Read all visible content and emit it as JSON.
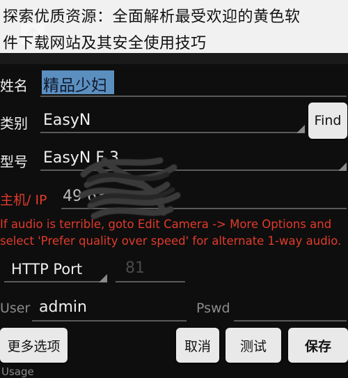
{
  "caption": {
    "line1": "探索优质资源：全面解析最受欢迎的黄色软",
    "line2": "件下载网站及其安全使用技巧"
  },
  "form": {
    "name_label": "姓名",
    "name_value": "精品少妇",
    "category_label": "类别",
    "category_value": "EasyN",
    "find_button": "Find",
    "model_label": "型号",
    "model_value": "EasyN F 3",
    "host_label": "主机/ IP",
    "host_value": "49 63",
    "warning_line1": "If audio is terrible, goto Edit Camera -> More Options and",
    "warning_line2": "select 'Prefer quality over speed' for alternate 1-way audio.",
    "port_type": "HTTP Port",
    "port_value": "81",
    "user_label": "User",
    "user_value": "admin",
    "pswd_label": "Pswd",
    "pswd_value": ""
  },
  "actions": {
    "more_options": "更多选项",
    "cancel": "取消",
    "test": "测试",
    "save": "保存"
  },
  "footer": {
    "partial_label": "Usage"
  },
  "colors": {
    "background": "#0e0e0e",
    "warning_red": "#e23b2b",
    "button_bg": "#e9e9e9",
    "selection_blue": "#5b8fc0"
  }
}
